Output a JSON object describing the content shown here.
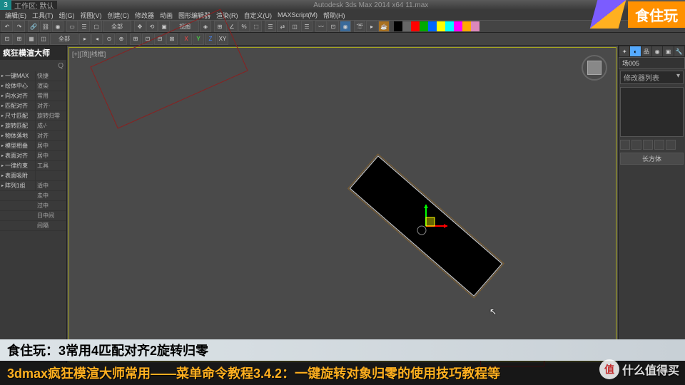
{
  "app": {
    "title": "Autodesk 3ds Max 2014 x64   11.max",
    "workspace": "工作区: 默认"
  },
  "menu": [
    "编辑(E)",
    "工具(T)",
    "组(G)",
    "视图(V)",
    "创建(C)",
    "修改器",
    "动画",
    "图形编辑器",
    "渲染(R)",
    "自定义(U)",
    "MAXScript(M)",
    "帮助(H)"
  ],
  "colors": [
    "#000",
    "#666",
    "#f00",
    "#0a0",
    "#06f",
    "#ff0",
    "#0ff",
    "#f0f",
    "#fa0",
    "#d8b"
  ],
  "toolbar2": {
    "label1": "全部",
    "label2": "视图"
  },
  "leftpanel": {
    "title": "疯狂模渲大师",
    "rows": [
      {
        "l": "一键MAX",
        "r": "快捷"
      },
      {
        "l": "绘体中心",
        "r": "渲染"
      },
      {
        "l": "向水对齐",
        "r": "常用"
      },
      {
        "l": "匹配对齐",
        "r": "对齐·"
      },
      {
        "l": "尺寸匹配",
        "r": "旋转归零"
      },
      {
        "l": "旋转匹配",
        "r": "成√·"
      },
      {
        "l": "物体落地",
        "r": "对齐"
      },
      {
        "l": "模型相叠",
        "r": "居中"
      },
      {
        "l": "表面对齐",
        "r": "居中"
      },
      {
        "l": "一律约束",
        "r": "工具"
      },
      {
        "l": "表面吸附",
        "r": ""
      },
      {
        "l": "阵列1组",
        "r": "适中"
      },
      {
        "l": "",
        "r": "走中"
      },
      {
        "l": "",
        "r": "过中"
      },
      {
        "l": "",
        "r": "日中间"
      },
      {
        "l": "",
        "r": "间隔"
      }
    ]
  },
  "viewport": {
    "label": "[+][顶][线框]"
  },
  "rightpanel": {
    "header": "场005",
    "dropdown": "修改器列表",
    "section": "长方体"
  },
  "overlay": {
    "brand": "食住玩"
  },
  "captions": {
    "line1": "食住玩：3常用4匹配对齐2旋转归零",
    "line2": "3dmax疯狂模渲大师常用——菜单命令教程3.4.2：一键旋转对象归零的使用技巧教程等"
  },
  "watermark": {
    "icon": "值",
    "text": "什么值得买"
  }
}
